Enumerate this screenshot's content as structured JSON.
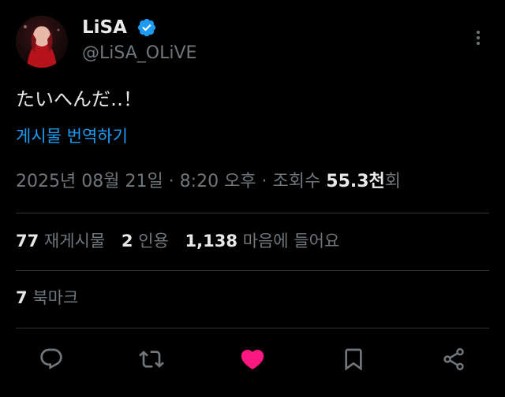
{
  "author": {
    "display_name": "LiSA",
    "handle": "@LiSA_OLiVE",
    "verified": true,
    "verified_color": "#1d9bf0"
  },
  "tweet": {
    "text": "たいへんだ‥！",
    "translate_label": "게시물 번역하기"
  },
  "meta": {
    "date": "2025년 08월 21일",
    "separator1": " · ",
    "time": "8:20 오후",
    "separator2": " · ",
    "views_label_prefix": "조회수 ",
    "views_value": "55.3천",
    "views_suffix": "회"
  },
  "stats": {
    "reposts_count": "77",
    "reposts_label": "재게시물",
    "quotes_count": "2",
    "quotes_label": "인용",
    "likes_count": "1,138",
    "likes_label": "마음에 들어요"
  },
  "bookmarks": {
    "count": "7",
    "label": "북마크"
  },
  "actions": {
    "reply_icon": "reply-icon",
    "repost_icon": "repost-icon",
    "like_icon": "heart-icon",
    "like_color": "#f91880",
    "bookmark_icon": "bookmark-icon",
    "share_icon": "share-icon"
  },
  "colors": {
    "background": "#000000",
    "text_primary": "#e7e9ea",
    "text_secondary": "#71767b",
    "link": "#1d9bf0",
    "divider": "#2f3336"
  }
}
